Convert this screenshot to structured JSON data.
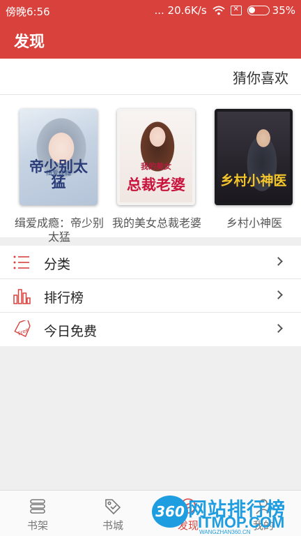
{
  "status_bar": {
    "time": "傍晚6:56",
    "network_speed": "... 20.6K/s",
    "battery_percent": "35%",
    "battery_level": 0.35
  },
  "app_bar": {
    "title": "发现"
  },
  "guess": {
    "header": "猜你喜欢",
    "books": [
      {
        "name": "缉爱成瘾：帝少别太猛",
        "cover_title": "帝少别太猛",
        "cover_sub": "缉爱成瘾"
      },
      {
        "name": "我的美女总裁老婆",
        "cover_title": "总裁老婆",
        "cover_sub": "我的美女"
      },
      {
        "name": "乡村小神医",
        "cover_title": "乡村小神医",
        "cover_sub": ""
      }
    ]
  },
  "menu": [
    {
      "label": "分类",
      "icon": "list-icon"
    },
    {
      "label": "排行榜",
      "icon": "bar-chart-icon"
    },
    {
      "label": "今日免费",
      "icon": "free-tag-icon"
    }
  ],
  "tabs": [
    {
      "label": "书架",
      "icon": "bookshelf-icon"
    },
    {
      "label": "书城",
      "icon": "tag-icon"
    },
    {
      "label": "发现",
      "icon": "discover-icon"
    },
    {
      "label": "我的",
      "icon": "user-icon"
    }
  ],
  "watermark": {
    "badge": "360",
    "title": "网站排行榜",
    "brand": "ITMOP.COM",
    "url": "WANGZHAN360.CN"
  },
  "colors": {
    "accent": "#d9413c",
    "watermark": "#1e9de0"
  }
}
